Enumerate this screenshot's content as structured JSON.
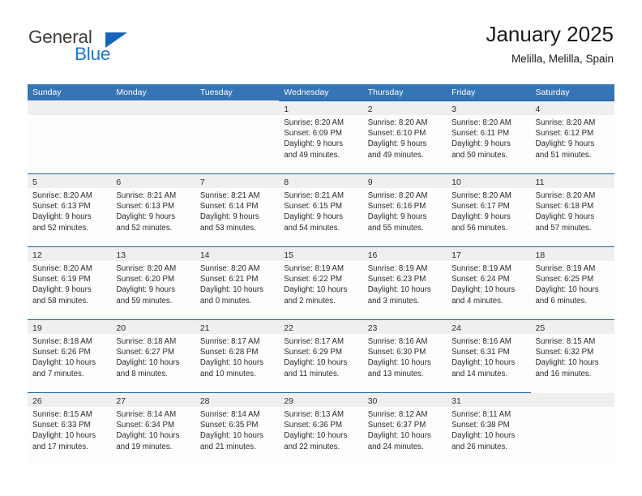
{
  "brand": {
    "name_part1": "General",
    "name_part2": "Blue",
    "flag_color": "#1565b8"
  },
  "header": {
    "title": "January 2025",
    "subtitle": "Melilla, Melilla, Spain"
  },
  "calendar": {
    "accent_color": "#3574b5",
    "row_line_color": "#1f63a8",
    "daynum_band_color": "#efefef",
    "day_headers": [
      "Sunday",
      "Monday",
      "Tuesday",
      "Wednesday",
      "Thursday",
      "Friday",
      "Saturday"
    ],
    "weeks": [
      [
        {
          "day": "",
          "lines": []
        },
        {
          "day": "",
          "lines": []
        },
        {
          "day": "",
          "lines": []
        },
        {
          "day": "1",
          "lines": [
            "Sunrise: 8:20 AM",
            "Sunset: 6:09 PM",
            "Daylight: 9 hours",
            "and 49 minutes."
          ]
        },
        {
          "day": "2",
          "lines": [
            "Sunrise: 8:20 AM",
            "Sunset: 6:10 PM",
            "Daylight: 9 hours",
            "and 49 minutes."
          ]
        },
        {
          "day": "3",
          "lines": [
            "Sunrise: 8:20 AM",
            "Sunset: 6:11 PM",
            "Daylight: 9 hours",
            "and 50 minutes."
          ]
        },
        {
          "day": "4",
          "lines": [
            "Sunrise: 8:20 AM",
            "Sunset: 6:12 PM",
            "Daylight: 9 hours",
            "and 51 minutes."
          ]
        }
      ],
      [
        {
          "day": "5",
          "lines": [
            "Sunrise: 8:20 AM",
            "Sunset: 6:13 PM",
            "Daylight: 9 hours",
            "and 52 minutes."
          ]
        },
        {
          "day": "6",
          "lines": [
            "Sunrise: 8:21 AM",
            "Sunset: 6:13 PM",
            "Daylight: 9 hours",
            "and 52 minutes."
          ]
        },
        {
          "day": "7",
          "lines": [
            "Sunrise: 8:21 AM",
            "Sunset: 6:14 PM",
            "Daylight: 9 hours",
            "and 53 minutes."
          ]
        },
        {
          "day": "8",
          "lines": [
            "Sunrise: 8:21 AM",
            "Sunset: 6:15 PM",
            "Daylight: 9 hours",
            "and 54 minutes."
          ]
        },
        {
          "day": "9",
          "lines": [
            "Sunrise: 8:20 AM",
            "Sunset: 6:16 PM",
            "Daylight: 9 hours",
            "and 55 minutes."
          ]
        },
        {
          "day": "10",
          "lines": [
            "Sunrise: 8:20 AM",
            "Sunset: 6:17 PM",
            "Daylight: 9 hours",
            "and 56 minutes."
          ]
        },
        {
          "day": "11",
          "lines": [
            "Sunrise: 8:20 AM",
            "Sunset: 6:18 PM",
            "Daylight: 9 hours",
            "and 57 minutes."
          ]
        }
      ],
      [
        {
          "day": "12",
          "lines": [
            "Sunrise: 8:20 AM",
            "Sunset: 6:19 PM",
            "Daylight: 9 hours",
            "and 58 minutes."
          ]
        },
        {
          "day": "13",
          "lines": [
            "Sunrise: 8:20 AM",
            "Sunset: 6:20 PM",
            "Daylight: 9 hours",
            "and 59 minutes."
          ]
        },
        {
          "day": "14",
          "lines": [
            "Sunrise: 8:20 AM",
            "Sunset: 6:21 PM",
            "Daylight: 10 hours",
            "and 0 minutes."
          ]
        },
        {
          "day": "15",
          "lines": [
            "Sunrise: 8:19 AM",
            "Sunset: 6:22 PM",
            "Daylight: 10 hours",
            "and 2 minutes."
          ]
        },
        {
          "day": "16",
          "lines": [
            "Sunrise: 8:19 AM",
            "Sunset: 6:23 PM",
            "Daylight: 10 hours",
            "and 3 minutes."
          ]
        },
        {
          "day": "17",
          "lines": [
            "Sunrise: 8:19 AM",
            "Sunset: 6:24 PM",
            "Daylight: 10 hours",
            "and 4 minutes."
          ]
        },
        {
          "day": "18",
          "lines": [
            "Sunrise: 8:19 AM",
            "Sunset: 6:25 PM",
            "Daylight: 10 hours",
            "and 6 minutes."
          ]
        }
      ],
      [
        {
          "day": "19",
          "lines": [
            "Sunrise: 8:18 AM",
            "Sunset: 6:26 PM",
            "Daylight: 10 hours",
            "and 7 minutes."
          ]
        },
        {
          "day": "20",
          "lines": [
            "Sunrise: 8:18 AM",
            "Sunset: 6:27 PM",
            "Daylight: 10 hours",
            "and 8 minutes."
          ]
        },
        {
          "day": "21",
          "lines": [
            "Sunrise: 8:17 AM",
            "Sunset: 6:28 PM",
            "Daylight: 10 hours",
            "and 10 minutes."
          ]
        },
        {
          "day": "22",
          "lines": [
            "Sunrise: 8:17 AM",
            "Sunset: 6:29 PM",
            "Daylight: 10 hours",
            "and 11 minutes."
          ]
        },
        {
          "day": "23",
          "lines": [
            "Sunrise: 8:16 AM",
            "Sunset: 6:30 PM",
            "Daylight: 10 hours",
            "and 13 minutes."
          ]
        },
        {
          "day": "24",
          "lines": [
            "Sunrise: 8:16 AM",
            "Sunset: 6:31 PM",
            "Daylight: 10 hours",
            "and 14 minutes."
          ]
        },
        {
          "day": "25",
          "lines": [
            "Sunrise: 8:15 AM",
            "Sunset: 6:32 PM",
            "Daylight: 10 hours",
            "and 16 minutes."
          ]
        }
      ],
      [
        {
          "day": "26",
          "lines": [
            "Sunrise: 8:15 AM",
            "Sunset: 6:33 PM",
            "Daylight: 10 hours",
            "and 17 minutes."
          ]
        },
        {
          "day": "27",
          "lines": [
            "Sunrise: 8:14 AM",
            "Sunset: 6:34 PM",
            "Daylight: 10 hours",
            "and 19 minutes."
          ]
        },
        {
          "day": "28",
          "lines": [
            "Sunrise: 8:14 AM",
            "Sunset: 6:35 PM",
            "Daylight: 10 hours",
            "and 21 minutes."
          ]
        },
        {
          "day": "29",
          "lines": [
            "Sunrise: 8:13 AM",
            "Sunset: 6:36 PM",
            "Daylight: 10 hours",
            "and 22 minutes."
          ]
        },
        {
          "day": "30",
          "lines": [
            "Sunrise: 8:12 AM",
            "Sunset: 6:37 PM",
            "Daylight: 10 hours",
            "and 24 minutes."
          ]
        },
        {
          "day": "31",
          "lines": [
            "Sunrise: 8:11 AM",
            "Sunset: 6:38 PM",
            "Daylight: 10 hours",
            "and 26 minutes."
          ]
        },
        {
          "day": "",
          "lines": []
        }
      ]
    ]
  }
}
